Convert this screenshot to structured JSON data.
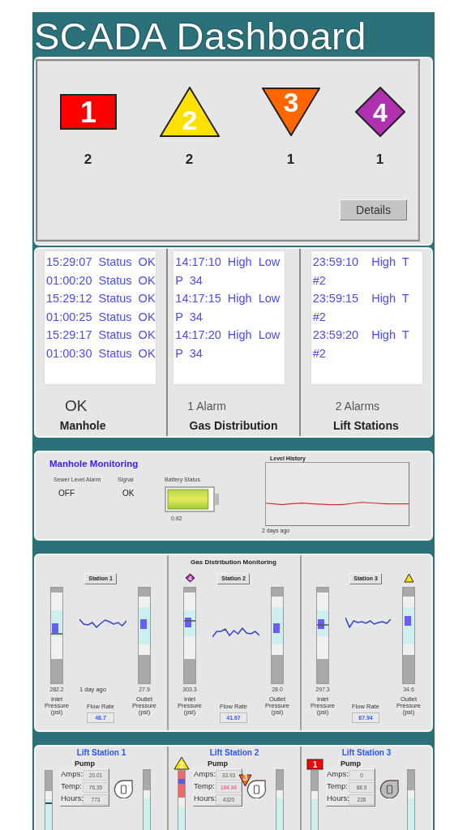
{
  "title": "SCADA Dashboard",
  "alarm_summary": {
    "priorities": [
      {
        "kind": "rectangle",
        "label": "1",
        "count": "2",
        "color": "#ff0000"
      },
      {
        "kind": "triangle",
        "label": "2",
        "count": "2",
        "color": "#ffe100"
      },
      {
        "kind": "inverted-triangle",
        "label": "3",
        "count": "1",
        "color": "#ff6600"
      },
      {
        "kind": "diamond",
        "label": "4",
        "count": "1",
        "color": "#b031b0"
      }
    ],
    "button": "Details"
  },
  "event_logs": [
    {
      "entries": [
        "15:29:07 Status OK",
        "01:00:20 Status OK",
        "15:29:12 Status OK",
        "01:00:25 Status OK",
        "15:29:17 Status OK",
        "01:00:30 Status OK"
      ],
      "status": "OK",
      "kind": "ok",
      "label": "Manhole"
    },
    {
      "entries": [
        "14:17:10 High Low P 34",
        "14:17:15 High Low P 34",
        "14:17:20 High Low P 34"
      ],
      "status": "1 Alarm",
      "kind": "alarm",
      "label": "Gas Distribution"
    },
    {
      "entries": [
        "23:59:10  High T #2",
        "23:59:15  High T #2",
        "23:59:20  High T #2"
      ],
      "status": "2 Alarms",
      "kind": "alarm",
      "label": "Lift Stations"
    }
  ],
  "manhole": {
    "title": "Manhole Monitoring",
    "fields": [
      {
        "label": "Sewer Level Alarm",
        "value": "OFF"
      },
      {
        "label": "Signal",
        "value": "OK"
      }
    ],
    "battery": {
      "label": "Battery Status",
      "level": 0.92,
      "reading": "0.92"
    },
    "level_history": {
      "title": "Level History",
      "caption": "2 days ago"
    }
  },
  "gas_distribution": {
    "title": "Gas Distribution Monitoring",
    "stations": [
      {
        "name": "Station 1",
        "inlet": {
          "level": 0.58,
          "setpoint": {
            "level": 0.52
          },
          "reading": "282.2",
          "label": "Inlet Pressure (psi)"
        },
        "outlet": {
          "level": 0.62,
          "reading": "27.9",
          "label": "Outlet Pressure (psi)"
        },
        "trend_caption": "1 day ago",
        "flow_label": "Flow Rate",
        "flow": "48.7"
      },
      {
        "name": "Station 2",
        "inlet": {
          "badge": {
            "kind": "diamond",
            "label": "4"
          },
          "level": 0.64,
          "setpoint": {
            "level": 0.65
          },
          "reading": "303.3",
          "label": "Inlet Pressure (psi)"
        },
        "outlet": {
          "level": 0.58,
          "reading": "28.0",
          "label": "Outlet Pressure (psi)"
        },
        "flow_label": "Flow Rate",
        "flow": "41.67"
      },
      {
        "name": "Station 3",
        "inlet": {
          "level": 0.62,
          "setpoint": {
            "level": 0.61
          },
          "reading": "297.3",
          "label": "Inlet Pressure (psi)"
        },
        "outlet": {
          "badge": {
            "kind": "triangle"
          },
          "level": 0.65,
          "reading": "34.6",
          "label": "Outlet Pressure (psi)"
        },
        "flow_label": "Flow Rate",
        "flow": "87.94"
      }
    ]
  },
  "lift_stations": [
    {
      "name": "Lift Station 1",
      "pump": {
        "label": "Pump",
        "running": true,
        "readings": [
          {
            "label": "Amps:",
            "value": "20.01",
            "alert": false
          },
          {
            "label": "Temp:",
            "value": "76.35",
            "alert": false
          },
          {
            "label": "Hours:",
            "value": "773",
            "alert": false
          }
        ]
      },
      "wet_well": {
        "level": 0.7,
        "alarm": false,
        "marker": {
          "level": 0.66
        }
      },
      "discharge": {
        "level": 0.7
      }
    },
    {
      "name": "Lift Station 2",
      "pump": {
        "label": "Pump",
        "badge": {
          "kind": "inverted-triangle",
          "label": "3"
        },
        "running": true,
        "readings": [
          {
            "label": "Amps:",
            "value": "33.93",
            "alert": false
          },
          {
            "label": "Temp:",
            "value": "104.94",
            "alert": true
          },
          {
            "label": "Hours:",
            "value": "4320",
            "alert": false
          }
        ]
      },
      "wet_well": {
        "badge": {
          "kind": "triangle",
          "label": "2"
        },
        "level": 0.63,
        "alarm": true,
        "marker": {
          "level": 0.89
        }
      },
      "discharge": {
        "level": 0.7
      }
    },
    {
      "name": "Lift Station 3",
      "pump": {
        "label": "Pump",
        "running": false,
        "readings": [
          {
            "label": "Amps:",
            "value": "0",
            "alert": false
          },
          {
            "label": "Temp:",
            "value": "68.9",
            "alert": false
          },
          {
            "label": "Hours:",
            "value": "228",
            "alert": false
          }
        ]
      },
      "wet_well": {
        "badge": {
          "kind": "rectangle",
          "label": "1"
        },
        "level": 0.7,
        "alarm": false
      },
      "discharge": {
        "level": 0.7
      }
    }
  ]
}
